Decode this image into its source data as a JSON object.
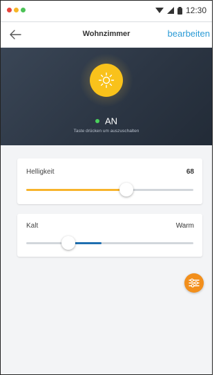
{
  "status_bar": {
    "time": "12:30",
    "dot_colors": [
      "#e8453c",
      "#f6b626",
      "#4cc257"
    ]
  },
  "header": {
    "back_icon": "arrow-left-icon",
    "title": "Wohnzimmer",
    "edit_label": "bearbeiten"
  },
  "lamp": {
    "state_label": "AN",
    "hint": "Taste drücken um auszuschalten",
    "icon": "sun-icon",
    "color": "#f9c21b"
  },
  "brightness": {
    "label": "Helligkeit",
    "value": "68",
    "level_fraction": 0.6,
    "accent": "#f7b42c"
  },
  "temperature": {
    "label_left": "Kalt",
    "label_right": "Warm",
    "level_fraction": 0.25,
    "accent": "#1f6fb0"
  },
  "fab": {
    "icon": "sliders-icon",
    "color": "#f28f1c"
  }
}
